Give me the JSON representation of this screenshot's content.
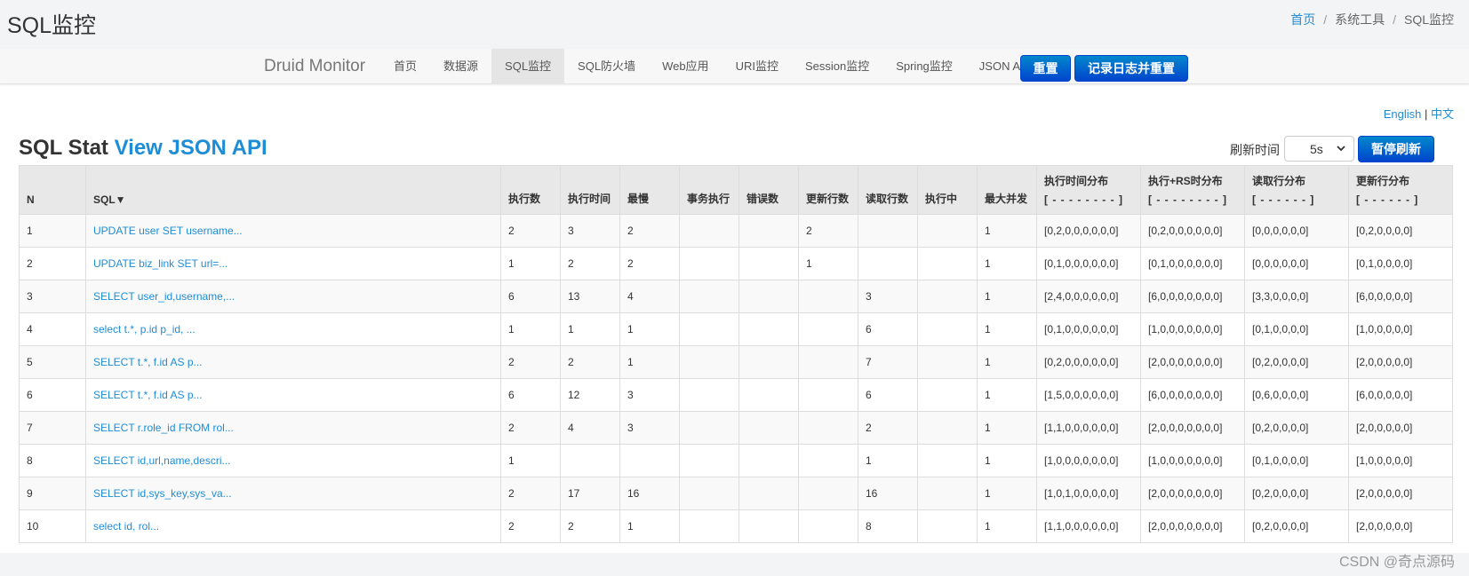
{
  "header": {
    "title": "SQL监控",
    "breadcrumb": {
      "home": "首页",
      "sep1": "/",
      "tools": "系统工具",
      "sep2": "/",
      "current": "SQL监控"
    }
  },
  "navbar": {
    "brand": "Druid Monitor",
    "items": [
      "首页",
      "数据源",
      "SQL监控",
      "SQL防火墙",
      "Web应用",
      "URI监控",
      "Session监控",
      "Spring监控",
      "JSON API"
    ],
    "active_index": 2,
    "reset_label": "重置",
    "log_reset_label": "记录日志并重置"
  },
  "lang": {
    "english": "English",
    "sep": "|",
    "chinese": "中文"
  },
  "stat": {
    "title": "SQL Stat",
    "json_link": "View JSON API",
    "refresh_label": "刷新时间",
    "refresh_value": "5s",
    "pause_label": "暂停刷新"
  },
  "table": {
    "headers": {
      "n": "N",
      "sql": "SQL▼",
      "exec_count": "执行数",
      "exec_time": "执行时间",
      "slowest": "最慢",
      "txn_exec": "事务执行",
      "error_count": "错误数",
      "update_rows": "更新行数",
      "fetch_rows": "读取行数",
      "running": "执行中",
      "max_concurrent": "最大并发",
      "exec_hist": "执行时间分布",
      "exec_hist_sub": "[ - - - - - - - - ]",
      "exec_rs_hist": "执行+RS时分布",
      "exec_rs_hist_sub": "[ - - - - - - - - ]",
      "fetch_hist": "读取行分布",
      "fetch_hist_sub": "[ - - - - - - ]",
      "update_hist": "更新行分布",
      "update_hist_sub": "[ - - - - - - ]"
    },
    "rows": [
      [
        "1",
        "UPDATE user SET username...",
        "2",
        "3",
        "2",
        "",
        "",
        "2",
        "",
        "",
        "1",
        "[0,2,0,0,0,0,0,0]",
        "[0,2,0,0,0,0,0,0]",
        "[0,0,0,0,0,0]",
        "[0,2,0,0,0,0]"
      ],
      [
        "2",
        "UPDATE biz_link SET url=...",
        "1",
        "2",
        "2",
        "",
        "",
        "1",
        "",
        "",
        "1",
        "[0,1,0,0,0,0,0,0]",
        "[0,1,0,0,0,0,0,0]",
        "[0,0,0,0,0,0]",
        "[0,1,0,0,0,0]"
      ],
      [
        "3",
        "SELECT user_id,username,...",
        "6",
        "13",
        "4",
        "",
        "",
        "",
        "3",
        "",
        "1",
        "[2,4,0,0,0,0,0,0]",
        "[6,0,0,0,0,0,0,0]",
        "[3,3,0,0,0,0]",
        "[6,0,0,0,0,0]"
      ],
      [
        "4",
        "select t.*, p.id p_id, ...",
        "1",
        "1",
        "1",
        "",
        "",
        "",
        "6",
        "",
        "1",
        "[0,1,0,0,0,0,0,0]",
        "[1,0,0,0,0,0,0,0]",
        "[0,1,0,0,0,0]",
        "[1,0,0,0,0,0]"
      ],
      [
        "5",
        "SELECT t.*, f.id AS p...",
        "2",
        "2",
        "1",
        "",
        "",
        "",
        "7",
        "",
        "1",
        "[0,2,0,0,0,0,0,0]",
        "[2,0,0,0,0,0,0,0]",
        "[0,2,0,0,0,0]",
        "[2,0,0,0,0,0]"
      ],
      [
        "6",
        "SELECT t.*, f.id AS p...",
        "6",
        "12",
        "3",
        "",
        "",
        "",
        "6",
        "",
        "1",
        "[1,5,0,0,0,0,0,0]",
        "[6,0,0,0,0,0,0,0]",
        "[0,6,0,0,0,0]",
        "[6,0,0,0,0,0]"
      ],
      [
        "7",
        "SELECT r.role_id FROM rol...",
        "2",
        "4",
        "3",
        "",
        "",
        "",
        "2",
        "",
        "1",
        "[1,1,0,0,0,0,0,0]",
        "[2,0,0,0,0,0,0,0]",
        "[0,2,0,0,0,0]",
        "[2,0,0,0,0,0]"
      ],
      [
        "8",
        "SELECT id,url,name,descri...",
        "1",
        "",
        "",
        "",
        "",
        "",
        "1",
        "",
        "1",
        "[1,0,0,0,0,0,0,0]",
        "[1,0,0,0,0,0,0,0]",
        "[0,1,0,0,0,0]",
        "[1,0,0,0,0,0]"
      ],
      [
        "9",
        "SELECT id,sys_key,sys_va...",
        "2",
        "17",
        "16",
        "",
        "",
        "",
        "16",
        "",
        "1",
        "[1,0,1,0,0,0,0,0]",
        "[2,0,0,0,0,0,0,0]",
        "[0,2,0,0,0,0]",
        "[2,0,0,0,0,0]"
      ],
      [
        "10",
        "select id, rol...",
        "2",
        "2",
        "1",
        "",
        "",
        "",
        "8",
        "",
        "1",
        "[1,1,0,0,0,0,0,0]",
        "[2,0,0,0,0,0,0,0]",
        "[0,2,0,0,0,0]",
        "[2,0,0,0,0,0]"
      ]
    ]
  },
  "watermark": "CSDN @奇点源码",
  "colors": {
    "link": "#1f8dd6",
    "button_blue_top": "#0088cc",
    "button_blue_bottom": "#0044cc",
    "header_bg": "#f3f4f6",
    "table_header_bg": "#e8e8e8"
  }
}
